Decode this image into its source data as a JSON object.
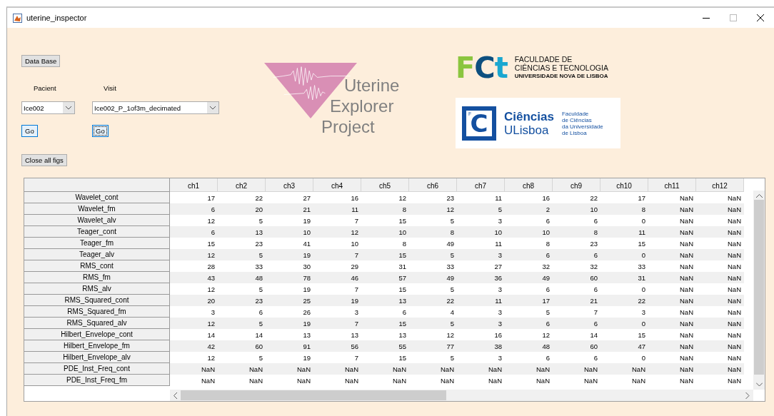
{
  "window": {
    "title": "uterine_inspector"
  },
  "controls": {
    "database_button": "Data Base",
    "pacient": {
      "label": "Pacient",
      "value": "Ice002",
      "go": "Go",
      "focused": false
    },
    "visit": {
      "label": "Visit",
      "value": "Ice002_P_1of3m_decimated",
      "go": "Go",
      "focused": true
    },
    "close_button": "Close all figs"
  },
  "project_logo": {
    "lines": [
      "Uterine",
      "Explorer",
      "Project"
    ]
  },
  "fct_logo": {
    "mark": "FCt",
    "lines": [
      "FACULDADE DE",
      "CIÊNCIAS E TECNOLOGIA",
      "UNIVERSIDADE NOVA DE LISBOA"
    ]
  },
  "ciencias_logo": {
    "mark_letter": "F",
    "mark": "C",
    "name": [
      "Ciências",
      "ULisboa"
    ],
    "subtitle": [
      "Faculdade",
      "de Ciências",
      "da Universidade",
      "de Lisboa"
    ]
  },
  "table": {
    "columns": [
      "ch1",
      "ch2",
      "ch3",
      "ch4",
      "ch5",
      "ch6",
      "ch7",
      "ch8",
      "ch9",
      "ch10",
      "ch11",
      "ch12"
    ],
    "rows": [
      {
        "label": "Wavelet_cont",
        "cells": [
          "17",
          "22",
          "27",
          "16",
          "12",
          "23",
          "11",
          "16",
          "22",
          "17",
          "NaN",
          "NaN"
        ]
      },
      {
        "label": "Wavelet_fm",
        "cells": [
          "6",
          "20",
          "21",
          "11",
          "8",
          "12",
          "5",
          "2",
          "10",
          "8",
          "NaN",
          "NaN"
        ]
      },
      {
        "label": "Wavelet_alv",
        "cells": [
          "12",
          "5",
          "19",
          "7",
          "15",
          "5",
          "3",
          "6",
          "6",
          "0",
          "NaN",
          "NaN"
        ]
      },
      {
        "label": "Teager_cont",
        "cells": [
          "6",
          "13",
          "10",
          "12",
          "10",
          "8",
          "10",
          "10",
          "8",
          "11",
          "NaN",
          "NaN"
        ]
      },
      {
        "label": "Teager_fm",
        "cells": [
          "15",
          "23",
          "41",
          "10",
          "8",
          "49",
          "11",
          "8",
          "23",
          "15",
          "NaN",
          "NaN"
        ]
      },
      {
        "label": "Teager_alv",
        "cells": [
          "12",
          "5",
          "19",
          "7",
          "15",
          "5",
          "3",
          "6",
          "6",
          "0",
          "NaN",
          "NaN"
        ]
      },
      {
        "label": "RMS_cont",
        "cells": [
          "28",
          "33",
          "30",
          "29",
          "31",
          "33",
          "27",
          "32",
          "32",
          "33",
          "NaN",
          "NaN"
        ]
      },
      {
        "label": "RMS_fm",
        "cells": [
          "43",
          "48",
          "78",
          "46",
          "57",
          "49",
          "36",
          "49",
          "60",
          "31",
          "NaN",
          "NaN"
        ]
      },
      {
        "label": "RMS_alv",
        "cells": [
          "12",
          "5",
          "19",
          "7",
          "15",
          "5",
          "3",
          "6",
          "6",
          "0",
          "NaN",
          "NaN"
        ]
      },
      {
        "label": "RMS_Squared_cont",
        "cells": [
          "20",
          "23",
          "25",
          "19",
          "13",
          "22",
          "11",
          "17",
          "21",
          "22",
          "NaN",
          "NaN"
        ]
      },
      {
        "label": "RMS_Squared_fm",
        "cells": [
          "3",
          "6",
          "26",
          "3",
          "6",
          "4",
          "3",
          "5",
          "7",
          "3",
          "NaN",
          "NaN"
        ]
      },
      {
        "label": "RMS_Squared_alv",
        "cells": [
          "12",
          "5",
          "19",
          "7",
          "15",
          "5",
          "3",
          "6",
          "6",
          "0",
          "NaN",
          "NaN"
        ]
      },
      {
        "label": "Hilbert_Envelope_cont",
        "cells": [
          "14",
          "14",
          "13",
          "13",
          "13",
          "12",
          "16",
          "12",
          "14",
          "15",
          "NaN",
          "NaN"
        ]
      },
      {
        "label": "Hilbert_Envelope_fm",
        "cells": [
          "42",
          "60",
          "91",
          "56",
          "55",
          "77",
          "38",
          "48",
          "60",
          "47",
          "NaN",
          "NaN"
        ]
      },
      {
        "label": "Hilbert_Envelope_alv",
        "cells": [
          "12",
          "5",
          "19",
          "7",
          "15",
          "5",
          "3",
          "6",
          "6",
          "0",
          "NaN",
          "NaN"
        ]
      },
      {
        "label": "PDE_Inst_Freq_cont",
        "cells": [
          "NaN",
          "NaN",
          "NaN",
          "NaN",
          "NaN",
          "NaN",
          "NaN",
          "NaN",
          "NaN",
          "NaN",
          "NaN",
          "NaN"
        ]
      },
      {
        "label": "PDE_Inst_Freq_fm",
        "cells": [
          "NaN",
          "NaN",
          "NaN",
          "NaN",
          "NaN",
          "NaN",
          "NaN",
          "NaN",
          "NaN",
          "NaN",
          "NaN",
          "NaN"
        ]
      }
    ]
  }
}
